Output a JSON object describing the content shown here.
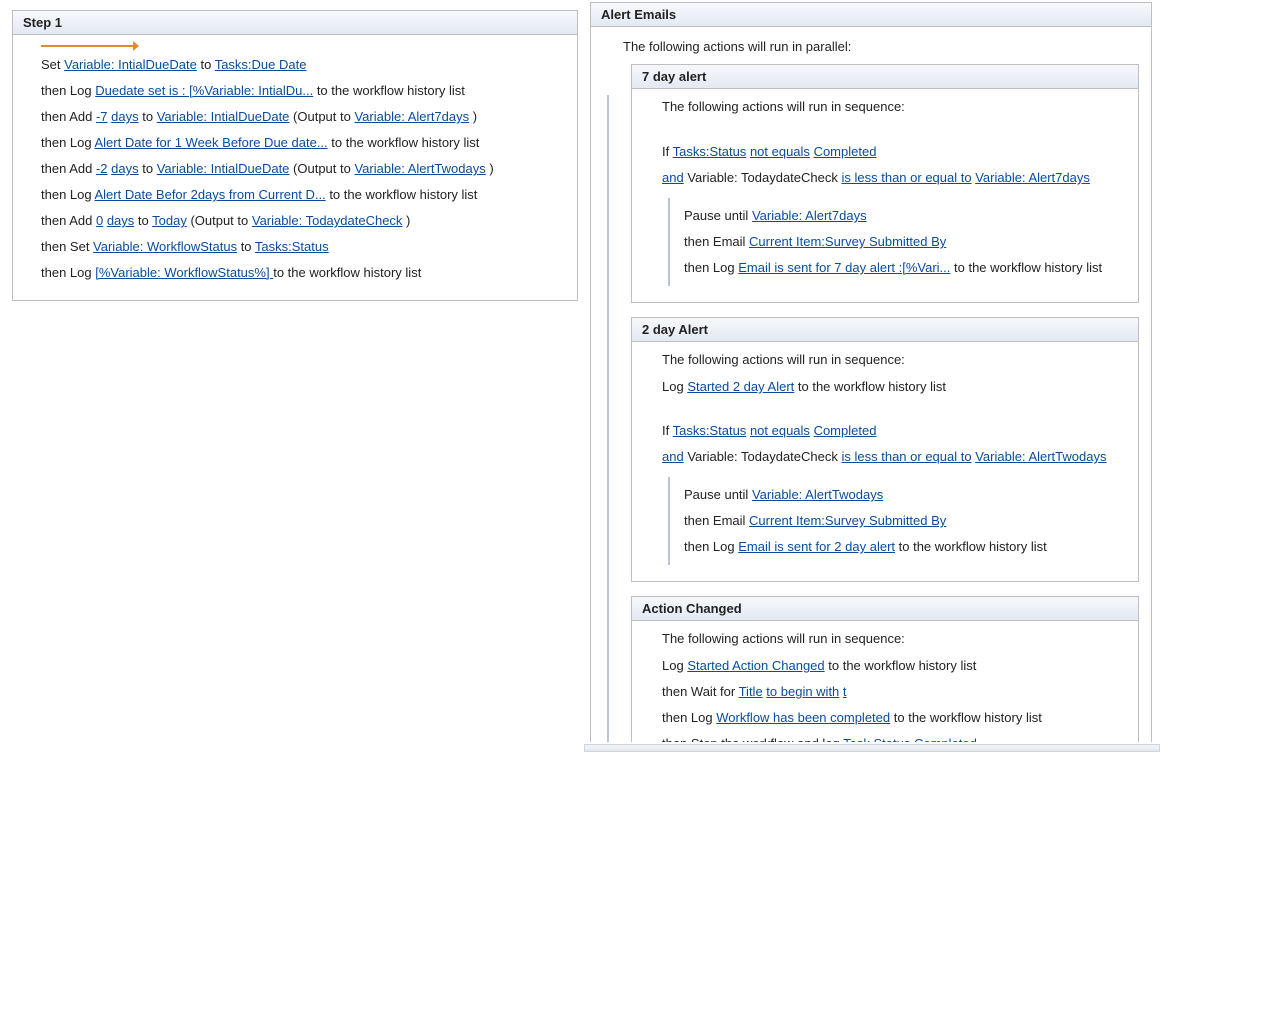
{
  "step1": {
    "title": "Step 1",
    "lines": {
      "l1": {
        "p1": "Set ",
        "link1": "Variable: IntialDueDate",
        "p2": " to ",
        "link2": "Tasks:Due Date"
      },
      "l2": {
        "p1": "then Log ",
        "link1": "Duedate set is : [%Variable: IntialDu...",
        "p2": "  to the workflow history list"
      },
      "l3": {
        "p1": "then Add ",
        "link1": "-7",
        "p2": " ",
        "link2": "days",
        "p3": " to ",
        "link3": "Variable: IntialDueDate",
        "p4": " (Output to ",
        "link4": "Variable: Alert7days",
        "p5": " )"
      },
      "l4": {
        "p1": "then Log ",
        "link1": "Alert Date for 1 Week Before Due date...",
        "p2": "  to the workflow history list"
      },
      "l5": {
        "p1": "then Add ",
        "link1": "-2",
        "p2": " ",
        "link2": "days",
        "p3": " to ",
        "link3": "Variable: IntialDueDate",
        "p4": " (Output to ",
        "link4": "Variable: AlertTwodays",
        "p5": " )"
      },
      "l6": {
        "p1": "then Log ",
        "link1": "Alert Date Befor 2days from Current D...",
        "p2": "  to the workflow history list"
      },
      "l7": {
        "p1": "then Add ",
        "link1": "0",
        "p2": " ",
        "link2": "days",
        "p3": " to ",
        "link3": "Today",
        "p4": " (Output to ",
        "link4": "Variable: TodaydateCheck",
        "p5": " )"
      },
      "l8": {
        "p1": "then Set ",
        "link1": "Variable: WorkflowStatus",
        "p2": " to ",
        "link2": "Tasks:Status"
      },
      "l9": {
        "p1": "then Log ",
        "link1": "[%Variable: WorkflowStatus%]   ",
        "p2": "  to the workflow history list"
      }
    }
  },
  "alertEmails": {
    "title": "Alert Emails",
    "parallelNote": "The following actions will run in parallel:",
    "sevenDay": {
      "title": "7 day alert",
      "seqNote": "The following actions will run in sequence:",
      "cond": {
        "p1": "If ",
        "link1": "Tasks:Status",
        "p2": " ",
        "link2": "not equals",
        "p3": " ",
        "link3": "Completed"
      },
      "cond2": {
        "p1": "and",
        "p2": "  Variable: TodaydateCheck ",
        "link1": "is less than or equal to",
        "p3": " ",
        "link2": "Variable: Alert7days"
      },
      "inner": {
        "a": {
          "p1": "Pause until ",
          "link1": "Variable: Alert7days"
        },
        "b": {
          "p1": "then Email ",
          "link1": "Current Item:Survey Submitted By"
        },
        "c": {
          "p1": "then Log ",
          "link1": "Email is sent for 7 day alert :[%Vari...",
          "p2": "  to the workflow history list"
        }
      }
    },
    "twoDay": {
      "title": "2 day Alert",
      "seqNote": "The following actions will run in sequence:",
      "pre": {
        "p1": "Log ",
        "link1": "Started 2 day Alert",
        "p2": "  to the workflow history list"
      },
      "cond": {
        "p1": "If ",
        "link1": "Tasks:Status",
        "p2": " ",
        "link2": "not equals",
        "p3": " ",
        "link3": "Completed"
      },
      "cond2": {
        "p1": "and",
        "p2": "  Variable: TodaydateCheck ",
        "link1": "is less than or equal to",
        "p3": " ",
        "link2": "Variable: AlertTwodays"
      },
      "inner": {
        "a": {
          "p1": "Pause until ",
          "link1": "Variable: AlertTwodays"
        },
        "b": {
          "p1": "then Email ",
          "link1": "Current Item:Survey Submitted By"
        },
        "c": {
          "p1": "then Log ",
          "link1": "Email is sent for 2 day alert",
          "p2": "  to the workflow history list"
        }
      }
    },
    "actionChanged": {
      "title": "Action Changed",
      "seqNote": "The following actions will run in sequence:",
      "a": {
        "p1": "Log ",
        "link1": "Started Action Changed",
        "p2": "  to the workflow history list"
      },
      "b": {
        "p1": "then Wait for ",
        "link1": "Title",
        "p2": " ",
        "link2": "to begin with",
        "p3": " ",
        "link3": "t"
      },
      "c": {
        "p1": "then Log ",
        "link1": "Workflow has been completed",
        "p2": "  to the workflow history list"
      },
      "d": {
        "p1": "then Stop the workflow and log ",
        "link1": "Task Status Completed"
      }
    }
  }
}
